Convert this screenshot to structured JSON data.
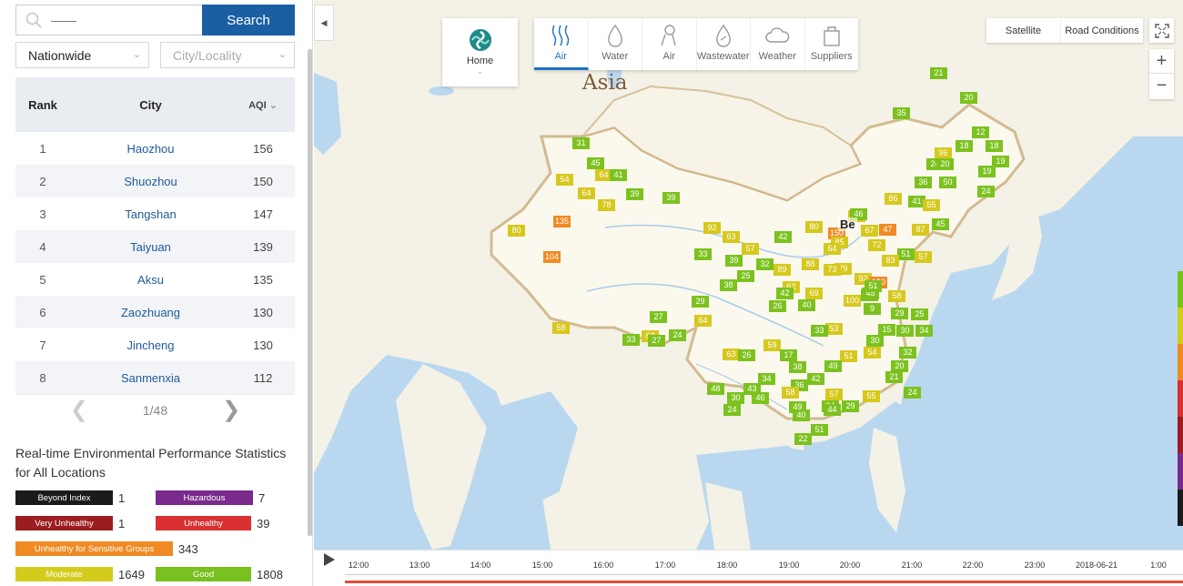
{
  "search": {
    "placeholder": "——",
    "button": "Search"
  },
  "filters": {
    "region": "Nationwide",
    "city_placeholder": "City/Locality"
  },
  "ranking": {
    "headers": {
      "rank": "Rank",
      "city": "City",
      "aqi": "AQI"
    },
    "rows": [
      {
        "rank": "1",
        "city": "Haozhou",
        "aqi": "156"
      },
      {
        "rank": "2",
        "city": "Shuozhou",
        "aqi": "150"
      },
      {
        "rank": "3",
        "city": "Tangshan",
        "aqi": "147"
      },
      {
        "rank": "4",
        "city": "Taiyuan",
        "aqi": "139"
      },
      {
        "rank": "5",
        "city": "Aksu",
        "aqi": "135"
      },
      {
        "rank": "6",
        "city": "Zaozhuang",
        "aqi": "130"
      },
      {
        "rank": "7",
        "city": "Jincheng",
        "aqi": "130"
      },
      {
        "rank": "8",
        "city": "Sanmenxia",
        "aqi": "112"
      }
    ],
    "pager": "1/48"
  },
  "stats": {
    "title": "Real-time Environmental Performance Statistics for All Locations",
    "items": [
      {
        "label": "Beyond Index",
        "count": "1",
        "color": "#1b1b1b"
      },
      {
        "label": "Hazardous",
        "count": "7",
        "color": "#7a2a8c"
      },
      {
        "label": "Very Unhealthy",
        "count": "1",
        "color": "#9b1d20"
      },
      {
        "label": "Unhealthy",
        "count": "39",
        "color": "#d83030"
      },
      {
        "label": "Unhealthy for Sensitive Groups",
        "count": "343",
        "color": "#f08a24"
      },
      {
        "label": "Moderate",
        "count": "1649",
        "color": "#d4cc1c"
      },
      {
        "label": "Good",
        "count": "1808",
        "color": "#79c11e"
      }
    ]
  },
  "map": {
    "continent_label": "Asia",
    "city_label": "Be",
    "home_label": "Home",
    "tabs": [
      {
        "label": "Air",
        "icon": "air-waves-icon",
        "active": true
      },
      {
        "label": "Water",
        "icon": "water-drop-icon"
      },
      {
        "label": "Air",
        "icon": "air-source-icon"
      },
      {
        "label": "Wastewater",
        "icon": "wastewater-icon"
      },
      {
        "label": "Weather",
        "icon": "cloud-icon"
      },
      {
        "label": "Suppliers",
        "icon": "bag-icon"
      }
    ],
    "view_buttons": {
      "satellite": "Satellite",
      "road": "Road Conditions"
    },
    "zoom_in": "+",
    "zoom_out": "−",
    "markers": [
      {
        "v": "21",
        "c": "g"
      },
      {
        "v": "20",
        "c": "g"
      },
      {
        "v": "35",
        "c": "g"
      },
      {
        "v": "31",
        "c": "g"
      },
      {
        "v": "45",
        "c": "g"
      },
      {
        "v": "64",
        "c": "y"
      },
      {
        "v": "41",
        "c": "g"
      },
      {
        "v": "54",
        "c": "y"
      },
      {
        "v": "64",
        "c": "y"
      },
      {
        "v": "39",
        "c": "g"
      },
      {
        "v": "78",
        "c": "y"
      },
      {
        "v": "39",
        "c": "g"
      },
      {
        "v": "80",
        "c": "y"
      },
      {
        "v": "135",
        "c": "o"
      },
      {
        "v": "104",
        "c": "o"
      },
      {
        "v": "58",
        "c": "y"
      },
      {
        "v": "27",
        "c": "g"
      },
      {
        "v": "33",
        "c": "g"
      },
      {
        "v": "62",
        "c": "y"
      },
      {
        "v": "27",
        "c": "g"
      },
      {
        "v": "24",
        "c": "g"
      },
      {
        "v": "64",
        "c": "y"
      },
      {
        "v": "29",
        "c": "g"
      },
      {
        "v": "33",
        "c": "g"
      },
      {
        "v": "92",
        "c": "y"
      },
      {
        "v": "63",
        "c": "y"
      },
      {
        "v": "57",
        "c": "y"
      },
      {
        "v": "42",
        "c": "g"
      },
      {
        "v": "39",
        "c": "g"
      },
      {
        "v": "32",
        "c": "g"
      },
      {
        "v": "25",
        "c": "g"
      },
      {
        "v": "38",
        "c": "g"
      },
      {
        "v": "89",
        "c": "y"
      },
      {
        "v": "62",
        "c": "y"
      },
      {
        "v": "69",
        "c": "y"
      },
      {
        "v": "74",
        "c": "y"
      },
      {
        "v": "80",
        "c": "y"
      },
      {
        "v": "150",
        "c": "o"
      },
      {
        "v": "85",
        "c": "y"
      },
      {
        "v": "64",
        "c": "y"
      },
      {
        "v": "88",
        "c": "y"
      },
      {
        "v": "79",
        "c": "y"
      },
      {
        "v": "73",
        "c": "y"
      },
      {
        "v": "92",
        "c": "y"
      },
      {
        "v": "130",
        "c": "o"
      },
      {
        "v": "67",
        "c": "y"
      },
      {
        "v": "47",
        "c": "o"
      },
      {
        "v": "72",
        "c": "y"
      },
      {
        "v": "51",
        "c": "g"
      },
      {
        "v": "83",
        "c": "y"
      },
      {
        "v": "86",
        "c": "y"
      },
      {
        "v": "41",
        "c": "g"
      },
      {
        "v": "55",
        "c": "y"
      },
      {
        "v": "87",
        "c": "y"
      },
      {
        "v": "57",
        "c": "y"
      },
      {
        "v": "36",
        "c": "g"
      },
      {
        "v": "50",
        "c": "g"
      },
      {
        "v": "18",
        "c": "g"
      },
      {
        "v": "96",
        "c": "y"
      },
      {
        "v": "24",
        "c": "g"
      },
      {
        "v": "20",
        "c": "g"
      },
      {
        "v": "12",
        "c": "g"
      },
      {
        "v": "18",
        "c": "g"
      },
      {
        "v": "19",
        "c": "g"
      },
      {
        "v": "19",
        "c": "g"
      },
      {
        "v": "24",
        "c": "g"
      },
      {
        "v": "45",
        "c": "g"
      },
      {
        "v": "46",
        "c": "g"
      },
      {
        "v": "34",
        "c": "g"
      },
      {
        "v": "26",
        "c": "g"
      },
      {
        "v": "42",
        "c": "g"
      },
      {
        "v": "40",
        "c": "g"
      },
      {
        "v": "100",
        "c": "y"
      },
      {
        "v": "45",
        "c": "g"
      },
      {
        "v": "58",
        "c": "y"
      },
      {
        "v": "29",
        "c": "g"
      },
      {
        "v": "53",
        "c": "y"
      },
      {
        "v": "33",
        "c": "g"
      },
      {
        "v": "15",
        "c": "g"
      },
      {
        "v": "59",
        "c": "y"
      },
      {
        "v": "30",
        "c": "g"
      },
      {
        "v": "32",
        "c": "g"
      },
      {
        "v": "17",
        "c": "g"
      },
      {
        "v": "51",
        "c": "y"
      },
      {
        "v": "38",
        "c": "g"
      },
      {
        "v": "63",
        "c": "y"
      },
      {
        "v": "26",
        "c": "g"
      },
      {
        "v": "34",
        "c": "g"
      },
      {
        "v": "42",
        "c": "g"
      },
      {
        "v": "49",
        "c": "g"
      },
      {
        "v": "36",
        "c": "g"
      },
      {
        "v": "20",
        "c": "g"
      },
      {
        "v": "21",
        "c": "g"
      },
      {
        "v": "48",
        "c": "g"
      },
      {
        "v": "43",
        "c": "g"
      },
      {
        "v": "46",
        "c": "g"
      },
      {
        "v": "58",
        "c": "y"
      },
      {
        "v": "57",
        "c": "y"
      },
      {
        "v": "55",
        "c": "y"
      },
      {
        "v": "24",
        "c": "g"
      },
      {
        "v": "30",
        "c": "g"
      },
      {
        "v": "24",
        "c": "g"
      },
      {
        "v": "49",
        "c": "g"
      },
      {
        "v": "34",
        "c": "g"
      },
      {
        "v": "40",
        "c": "g"
      },
      {
        "v": "44",
        "c": "g"
      },
      {
        "v": "29",
        "c": "g"
      },
      {
        "v": "51",
        "c": "g"
      },
      {
        "v": "22",
        "c": "g"
      },
      {
        "v": "30",
        "c": "g"
      },
      {
        "v": "34",
        "c": "g"
      },
      {
        "v": "25",
        "c": "g"
      },
      {
        "v": "9",
        "c": "g"
      },
      {
        "v": "54",
        "c": "y"
      },
      {
        "v": "51",
        "c": "g"
      }
    ]
  },
  "timeline": {
    "labels": [
      "12:00",
      "13:00",
      "14:00",
      "15:00",
      "16:00",
      "17:00",
      "18:00",
      "19:00",
      "20:00",
      "21:00",
      "22:00",
      "23:00",
      "2018-06-21",
      "1:00"
    ]
  },
  "colors": {
    "good": "#7cc21f",
    "moderate": "#d6c81d",
    "sensitive": "#f08a24",
    "accent": "#1b5fa3"
  }
}
